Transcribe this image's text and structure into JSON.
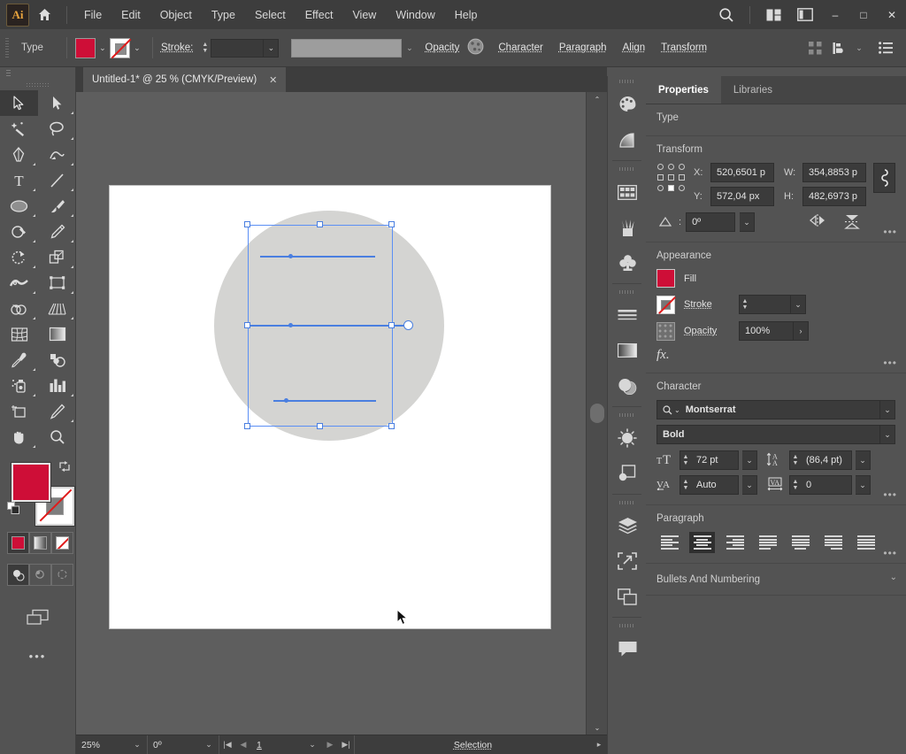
{
  "app": {
    "name": "Adobe Illustrator",
    "logo_text": "Ai"
  },
  "menubar": {
    "items": [
      {
        "label": "File",
        "name": "menu-file"
      },
      {
        "label": "Edit",
        "name": "menu-edit"
      },
      {
        "label": "Object",
        "name": "menu-object"
      },
      {
        "label": "Type",
        "name": "menu-type"
      },
      {
        "label": "Select",
        "name": "menu-select"
      },
      {
        "label": "Effect",
        "name": "menu-effect"
      },
      {
        "label": "View",
        "name": "menu-view"
      },
      {
        "label": "Window",
        "name": "menu-window"
      },
      {
        "label": "Help",
        "name": "menu-help"
      }
    ],
    "search_icon": "search-icon",
    "arrange_icon": "arrange-documents-icon",
    "workspace_icon": "workspace-switcher-icon",
    "minimize": "–",
    "maximize": "□",
    "close": "✕"
  },
  "controlbar": {
    "context_label": "Type",
    "fill_color": "#ce0e37",
    "stroke_color": "none",
    "stroke_label": "Stroke:",
    "stroke_weight": "",
    "profile_value": "",
    "opacity_label": "Opacity",
    "character_label": "Character",
    "paragraph_label": "Paragraph",
    "align_label": "Align",
    "transform_label": "Transform",
    "right_icons": [
      "distribute-icon",
      "arrange-icon",
      "options-list-icon"
    ]
  },
  "toolbar": {
    "tools": [
      {
        "name": "selection-tool",
        "label": "Selection",
        "selected": true
      },
      {
        "name": "direct-selection-tool",
        "label": "Direct Selection",
        "selected": false
      },
      {
        "name": "magic-wand-tool",
        "label": "Magic Wand",
        "selected": false
      },
      {
        "name": "lasso-tool",
        "label": "Lasso",
        "selected": false
      },
      {
        "name": "pen-tool",
        "label": "Pen",
        "selected": false
      },
      {
        "name": "curvature-tool",
        "label": "Curvature",
        "selected": false
      },
      {
        "name": "type-tool",
        "label": "Type",
        "selected": false
      },
      {
        "name": "line-segment-tool",
        "label": "Line Segment",
        "selected": false
      },
      {
        "name": "ellipse-tool",
        "label": "Ellipse",
        "selected": false
      },
      {
        "name": "paintbrush-tool",
        "label": "Paintbrush",
        "selected": false
      },
      {
        "name": "shaper-tool",
        "label": "Shaper",
        "selected": false
      },
      {
        "name": "pencil-tool",
        "label": "Pencil",
        "selected": false
      },
      {
        "name": "rotate-tool",
        "label": "Rotate",
        "selected": false
      },
      {
        "name": "scale-tool",
        "label": "Scale",
        "selected": false
      },
      {
        "name": "width-tool",
        "label": "Width",
        "selected": false
      },
      {
        "name": "free-transform-tool",
        "label": "Free Transform",
        "selected": false
      },
      {
        "name": "shape-builder-tool",
        "label": "Shape Builder",
        "selected": false
      },
      {
        "name": "perspective-grid-tool",
        "label": "Perspective Grid",
        "selected": false
      },
      {
        "name": "mesh-tool",
        "label": "Mesh",
        "selected": false
      },
      {
        "name": "gradient-tool",
        "label": "Gradient",
        "selected": false
      },
      {
        "name": "eyedropper-tool",
        "label": "Eyedropper",
        "selected": false
      },
      {
        "name": "blend-tool",
        "label": "Blend",
        "selected": false
      },
      {
        "name": "symbol-sprayer-tool",
        "label": "Symbol Sprayer",
        "selected": false
      },
      {
        "name": "column-graph-tool",
        "label": "Column Graph",
        "selected": false
      },
      {
        "name": "artboard-tool",
        "label": "Artboard",
        "selected": false
      },
      {
        "name": "slice-tool",
        "label": "Slice",
        "selected": false
      },
      {
        "name": "hand-tool",
        "label": "Hand",
        "selected": false
      },
      {
        "name": "zoom-tool",
        "label": "Zoom",
        "selected": false
      }
    ],
    "fill_color": "#ce0e37",
    "stroke_color": "none",
    "color_modes": [
      {
        "name": "color-mode-button",
        "selected": true
      },
      {
        "name": "gradient-mode-button",
        "selected": false
      },
      {
        "name": "none-mode-button",
        "selected": false
      }
    ],
    "draw_modes": [
      {
        "name": "draw-normal-button",
        "selected": true
      },
      {
        "name": "draw-behind-button",
        "selected": false
      },
      {
        "name": "draw-inside-button",
        "selected": false
      }
    ],
    "screen_mode_icon": "change-screen-mode-icon",
    "more_tools": "•••"
  },
  "document": {
    "tab_title": "Untitled-1* @ 25 % (CMYK/Preview)",
    "close_label": "✕"
  },
  "canvas": {
    "artboard_bg": "#ffffff",
    "shape_color": "#d4d4d2",
    "selection_color": "#4a7fe0",
    "cursor": "arrow-cursor"
  },
  "statusbar": {
    "zoom": "25%",
    "rotation": "0º",
    "page": "1",
    "status_text": "Selection",
    "nav_first": "|◀",
    "nav_prev": "◀",
    "nav_next": "▶",
    "nav_last": "▶|"
  },
  "icondock": {
    "groups": [
      [
        "color-panel-icon",
        "color-guide-icon"
      ],
      [
        "swatches-panel-icon",
        "brushes-panel-icon",
        "symbols-panel-icon"
      ],
      [
        "stroke-panel-icon",
        "gradient-panel-icon",
        "transparency-panel-icon"
      ],
      [
        "appearance-panel-icon",
        "pathfinder-panel-icon"
      ],
      [
        "layers-panel-icon",
        "asset-export-panel-icon",
        "artboards-panel-icon"
      ],
      [
        "comments-panel-icon"
      ]
    ]
  },
  "properties": {
    "tabs": [
      {
        "label": "Properties",
        "active": true,
        "name": "tab-properties"
      },
      {
        "label": "Libraries",
        "active": false,
        "name": "tab-libraries"
      }
    ],
    "type_section": {
      "title": "Type"
    },
    "transform": {
      "title": "Transform",
      "x_label": "X:",
      "x_value": "520,6501 p",
      "y_label": "Y:",
      "y_value": "572,04 px",
      "w_label": "W:",
      "w_value": "354,8853 p",
      "h_label": "H:",
      "h_value": "482,6973 p",
      "angle_value": "0º",
      "link_icon": "constrain-proportions-icon",
      "flip_h_icon": "flip-horizontal-icon",
      "flip_v_icon": "flip-vertical-icon",
      "more": "•••"
    },
    "appearance": {
      "title": "Appearance",
      "fill_label": "Fill",
      "fill_color": "#ce0e37",
      "stroke_label": "Stroke",
      "stroke_value": "",
      "opacity_label": "Opacity",
      "opacity_value": "100%",
      "fx_label": "fx.",
      "more": "•••"
    },
    "character": {
      "title": "Character",
      "font_family": "Montserrat",
      "font_style": "Bold",
      "font_size": "72 pt",
      "leading": "(86,4 pt)",
      "kerning": "Auto",
      "tracking": "0",
      "more": "•••"
    },
    "paragraph": {
      "title": "Paragraph",
      "align_buttons": [
        {
          "name": "align-left-button",
          "selected": false
        },
        {
          "name": "align-center-button",
          "selected": true
        },
        {
          "name": "align-right-button",
          "selected": false
        },
        {
          "name": "justify-last-left-button",
          "selected": false
        },
        {
          "name": "justify-last-center-button",
          "selected": false
        },
        {
          "name": "justify-last-right-button",
          "selected": false
        },
        {
          "name": "justify-all-button",
          "selected": false
        }
      ],
      "more": "•••"
    },
    "bullets": {
      "title": "Bullets And Numbering"
    }
  }
}
